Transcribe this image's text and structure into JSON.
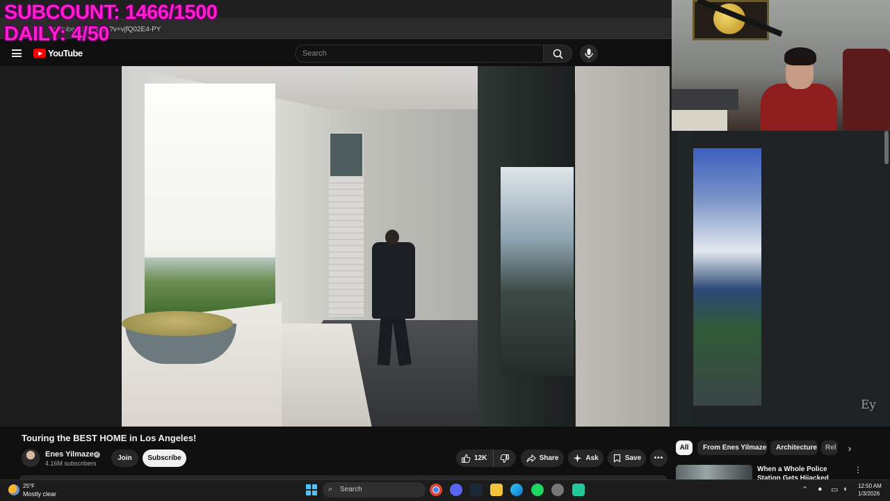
{
  "overlay": {
    "subcount": "SUBCOUNT: 1466/1500",
    "daily": "DAILY: 4/50"
  },
  "browser": {
    "url_prefix": "youtube.co",
    "url": "m/watch?v=vjfQ02E4-PY"
  },
  "youtube": {
    "logo_text": "YouTube",
    "search": {
      "placeholder": "Search"
    }
  },
  "video": {
    "title": "Touring the BEST HOME in Los Angeles!",
    "watermark": "Ey"
  },
  "channel": {
    "name": "Enes Yilmazer",
    "subscribers": "4.16M subscribers",
    "join_label": "Join",
    "subscribe_label": "Subscribe"
  },
  "actions": {
    "likes": "12K",
    "share": "Share",
    "ask": "Ask",
    "save": "Save",
    "more": "•••"
  },
  "chips": [
    "All",
    "From Enes Yilmazer",
    "Architecture",
    "Rel"
  ],
  "recommendation": {
    "title": "When a Whole Police Station Gets Hijacked",
    "more": "⋮"
  },
  "taskbar": {
    "temperature": "25°F",
    "condition": "Mostly clear",
    "search_label": "Search",
    "time": "12:50 AM",
    "date": "1/3/2026"
  },
  "colors": {
    "overlay_text": "#ff1ecf",
    "youtube_red": "#ff0000",
    "background": "#0f0f0f"
  },
  "icons": [
    "menu-icon",
    "search-icon",
    "mic-icon",
    "verified-icon",
    "like-icon",
    "dislike-icon",
    "share-icon",
    "sparkle-icon",
    "save-icon",
    "chevron-right-icon",
    "windows-icon",
    "chrome-icon",
    "discord-icon",
    "steam-icon",
    "folder-icon",
    "edge-icon",
    "spotify-icon",
    "settings-icon",
    "app-icon"
  ]
}
